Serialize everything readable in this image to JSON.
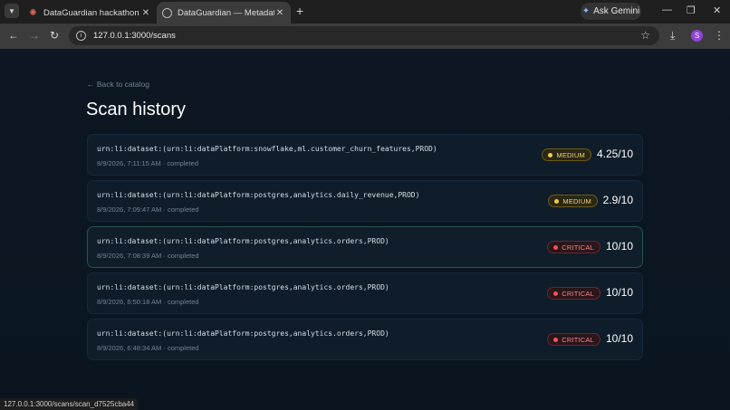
{
  "browser": {
    "tabs": [
      {
        "title": "DataGuardian hackathon projec"
      },
      {
        "title": "DataGuardian — Metadata-Awa"
      }
    ],
    "gemini_label": "Ask Gemini",
    "url": "127.0.0.1:3000/scans",
    "profile_initial": "S",
    "status_url": "127.0.0.1:3000/scans/scan_d7525cba44"
  },
  "page": {
    "back_link": "← Back to catalog",
    "title": "Scan history"
  },
  "scans": [
    {
      "urn": "urn:li:dataset:(urn:li:dataPlatform:snowflake,ml.customer_churn_features,PROD)",
      "meta": "8/9/2026, 7:11:15 AM · completed",
      "severity": "MEDIUM",
      "score": "4.25/10"
    },
    {
      "urn": "urn:li:dataset:(urn:li:dataPlatform:postgres,analytics.daily_revenue,PROD)",
      "meta": "8/9/2026, 7:09:47 AM · completed",
      "severity": "MEDIUM",
      "score": "2.9/10"
    },
    {
      "urn": "urn:li:dataset:(urn:li:dataPlatform:postgres,analytics.orders,PROD)",
      "meta": "8/9/2026, 7:08:39 AM · completed",
      "severity": "CRITICAL",
      "score": "10/10"
    },
    {
      "urn": "urn:li:dataset:(urn:li:dataPlatform:postgres,analytics.orders,PROD)",
      "meta": "8/9/2026, 6:50:18 AM · completed",
      "severity": "CRITICAL",
      "score": "10/10"
    },
    {
      "urn": "urn:li:dataset:(urn:li:dataPlatform:postgres,analytics.orders,PROD)",
      "meta": "8/9/2026, 6:48:34 AM · completed",
      "severity": "CRITICAL",
      "score": "10/10"
    }
  ],
  "colors": {
    "medium": "#f2c94c",
    "critical": "#f0525e",
    "background": "#0b1622"
  }
}
